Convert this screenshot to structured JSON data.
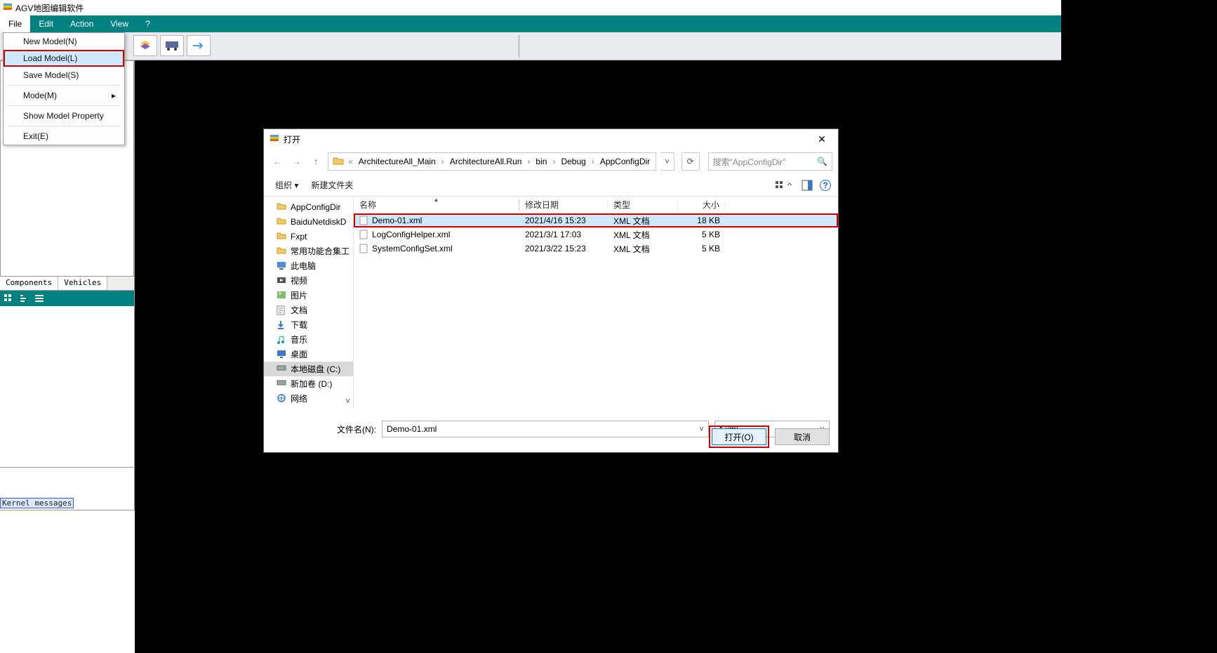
{
  "app": {
    "title": "AGV地图编辑软件"
  },
  "menubar": {
    "file": "File",
    "edit": "Edit",
    "action": "Action",
    "view": "View",
    "help": "?"
  },
  "file_menu": {
    "new_model": "New Model(N)",
    "load_model": "Load Model(L)",
    "save_model": "Save Model(S)",
    "mode": "Mode(M)",
    "show_prop": "Show Model Property",
    "exit": "Exit(E)"
  },
  "side_tabs": {
    "components": "Components",
    "vehicles": "Vehicles"
  },
  "kernel_label": "Kernel messages",
  "dialog": {
    "title": "打开",
    "breadcrumb_prefix": "«",
    "breadcrumbs": [
      "ArchitectureAll_Main",
      "ArchitectureAll.Run",
      "bin",
      "Debug",
      "AppConfigDir"
    ],
    "search_placeholder": "搜索\"AppConfigDir\"",
    "toolbar": {
      "organize": "组织",
      "new_folder": "新建文件夹"
    },
    "tree": [
      {
        "label": "AppConfigDir",
        "icon": "folder"
      },
      {
        "label": "BaiduNetdiskD",
        "icon": "folder"
      },
      {
        "label": "Fxpt",
        "icon": "folder"
      },
      {
        "label": "常用功能合集工",
        "icon": "folder"
      },
      {
        "label": "此电脑",
        "icon": "pc",
        "bold": true
      },
      {
        "label": "视频",
        "icon": "video"
      },
      {
        "label": "图片",
        "icon": "pic"
      },
      {
        "label": "文档",
        "icon": "doc"
      },
      {
        "label": "下载",
        "icon": "dl"
      },
      {
        "label": "音乐",
        "icon": "music"
      },
      {
        "label": "桌面",
        "icon": "desk"
      },
      {
        "label": "本地磁盘 (C:)",
        "icon": "drive",
        "sel": true
      },
      {
        "label": "新加卷 (D:)",
        "icon": "drive"
      },
      {
        "label": "网络",
        "icon": "net",
        "bold": true
      }
    ],
    "columns": {
      "name": "名称",
      "date": "修改日期",
      "type": "类型",
      "size": "大小"
    },
    "files": [
      {
        "name": "Demo-01.xml",
        "date": "2021/4/16 15:23",
        "type": "XML 文档",
        "size": "18 KB",
        "sel": true
      },
      {
        "name": "LogConfigHelper.xml",
        "date": "2021/3/1 17:03",
        "type": "XML 文档",
        "size": "5 KB"
      },
      {
        "name": "SystemConfigSet.xml",
        "date": "2021/3/22 15:23",
        "type": "XML 文档",
        "size": "5 KB"
      }
    ],
    "filename_label": "文件名(N):",
    "filename_value": "Demo-01.xml",
    "filter_value": "*.xml",
    "open_btn": "打开(O)",
    "cancel_btn": "取消"
  }
}
